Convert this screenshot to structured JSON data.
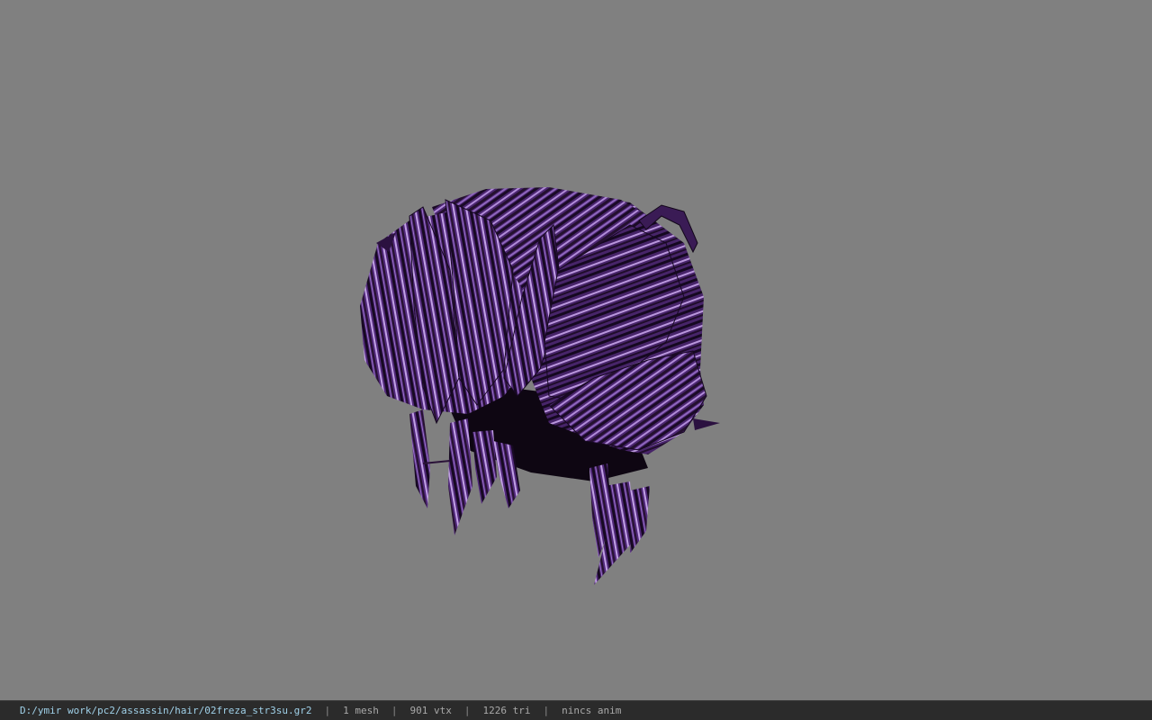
{
  "statusbar": {
    "file_path": "D:/ymir work/pc2/assassin/hair/02freza_str3su.gr2",
    "separator": "|",
    "mesh_count": "1 mesh",
    "vertex_count": "901 vtx",
    "triangle_count": "1226 tri",
    "animation": "nincs anim"
  },
  "colors": {
    "viewport_background": "#808080",
    "statusbar_background": "#2b2b2b",
    "path_text": "#9fd0e8",
    "info_text": "#a9a9a9",
    "hair_dark": "#2a1238",
    "hair_mid": "#5a2d86",
    "hair_light": "#b08ad8"
  }
}
